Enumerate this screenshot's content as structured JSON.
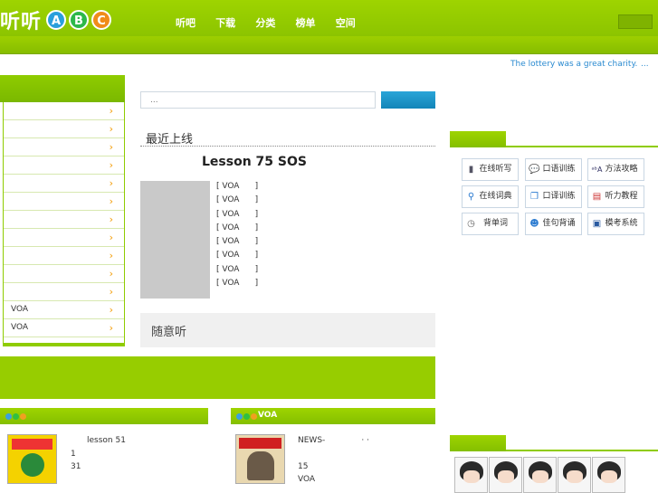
{
  "header": {
    "logo_text": "听听",
    "logo_letters": [
      "A",
      "B",
      "C"
    ],
    "nav": [
      "听吧",
      "下载",
      "分类",
      "榜单",
      "空间"
    ]
  },
  "ticker": {
    "text": "The lottery was a great charity.",
    "more": "..."
  },
  "sidebar": {
    "items": [
      "",
      "",
      "",
      "",
      "",
      "",
      "",
      "",
      "",
      "",
      "",
      "VOA",
      "VOA"
    ]
  },
  "search": {
    "placeholder": "..."
  },
  "recent": {
    "title": "最近上线",
    "lesson_title": "Lesson 75 SOS",
    "voa_items": [
      "[ VOA      ]",
      "[ VOA      ]",
      "[ VOA      ]",
      "[ VOA      ]",
      "[ VOA      ]",
      "[ VOA      ]",
      "[ VOA      ]",
      "[ VOA      ]"
    ]
  },
  "random": {
    "title": "随意听"
  },
  "panel_left": {
    "title": "",
    "line1": "lesson 51",
    "line2": "1",
    "line3": "31"
  },
  "panel_right": {
    "title": "VOA",
    "line1": "NEWS-              · ·",
    "line2": "15",
    "line3": "VOA"
  },
  "tools": [
    {
      "label": "在线听写",
      "icon": "dictation-icon"
    },
    {
      "label": "口语训练",
      "icon": "chat-icon"
    },
    {
      "label": "方法攻略",
      "icon": "abc-icon"
    },
    {
      "label": "在线词典",
      "icon": "magnifier-icon"
    },
    {
      "label": "口译训练",
      "icon": "copy-icon"
    },
    {
      "label": "听力教程",
      "icon": "document-icon"
    },
    {
      "label": "背单词",
      "icon": "clock-icon"
    },
    {
      "label": "佳句背诵",
      "icon": "person-icon"
    },
    {
      "label": "模考系统",
      "icon": "screen-icon"
    }
  ],
  "colors": {
    "brand_green": "#8fcc00",
    "link_blue": "#2a8ad0",
    "search_blue": "#1a94c8"
  }
}
